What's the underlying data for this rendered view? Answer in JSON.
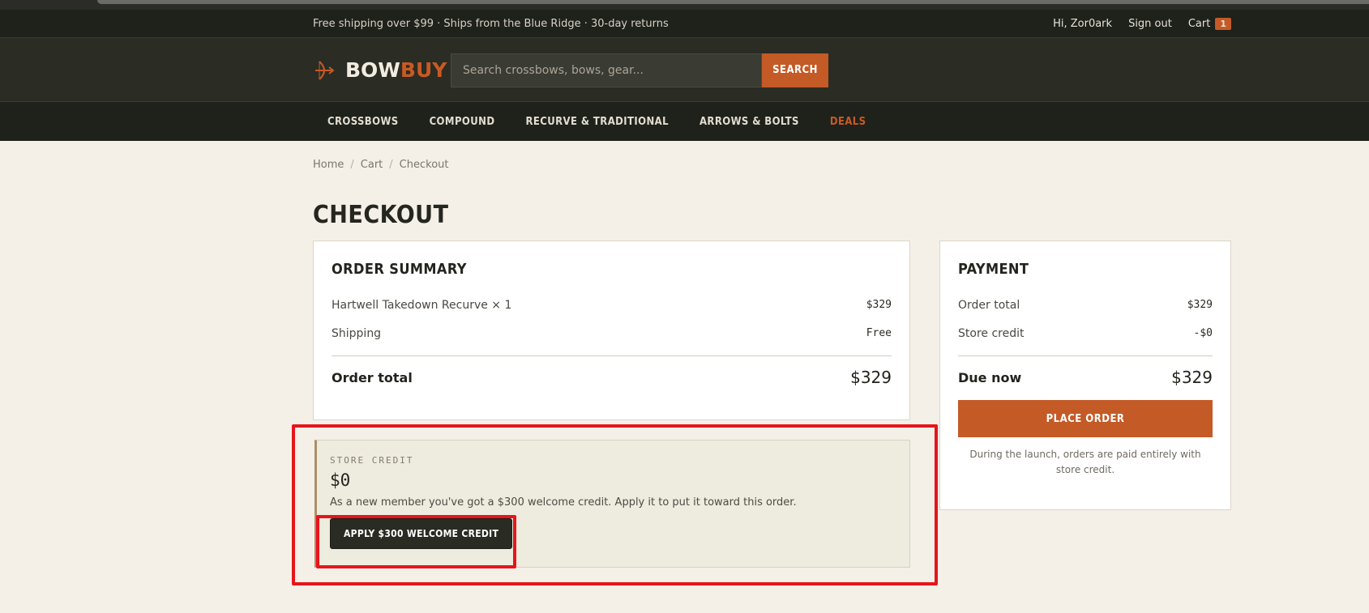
{
  "topbar": {
    "promo": "Free shipping over $99 · Ships from the Blue Ridge · 30-day returns",
    "greeting": "Hi, Zor0ark",
    "sign_out": "Sign out",
    "cart_label": "Cart",
    "cart_count": "1"
  },
  "header": {
    "logo_part1": "BOW",
    "logo_part2": "BUY",
    "search_placeholder": "Search crossbows, bows, gear...",
    "search_button": "SEARCH",
    "accent_color": "#c45a26"
  },
  "nav": {
    "items": [
      "CROSSBOWS",
      "COMPOUND",
      "RECURVE & TRADITIONAL",
      "ARROWS & BOLTS",
      "DEALS"
    ]
  },
  "breadcrumb": [
    "Home",
    "Cart",
    "Checkout"
  ],
  "page_title": "CHECKOUT",
  "order_summary": {
    "title": "ORDER SUMMARY",
    "item_label": "Hartwell Takedown Recurve × 1",
    "item_price": "$329",
    "shipping_label": "Shipping",
    "shipping_value": "Free",
    "total_label": "Order total",
    "total_value": "$329"
  },
  "payment": {
    "title": "PAYMENT",
    "order_total_label": "Order total",
    "order_total_value": "$329",
    "store_credit_label": "Store credit",
    "store_credit_value": "-$0",
    "due_label": "Due now",
    "due_value": "$329",
    "place_order": "PLACE ORDER",
    "note": "During the launch, orders are paid entirely with store credit."
  },
  "store_credit": {
    "label": "STORE CREDIT",
    "amount": "$0",
    "description": "As a new member you've got a $300 welcome credit. Apply it to put it toward this order.",
    "apply_button": "APPLY $300 WELCOME CREDIT"
  }
}
